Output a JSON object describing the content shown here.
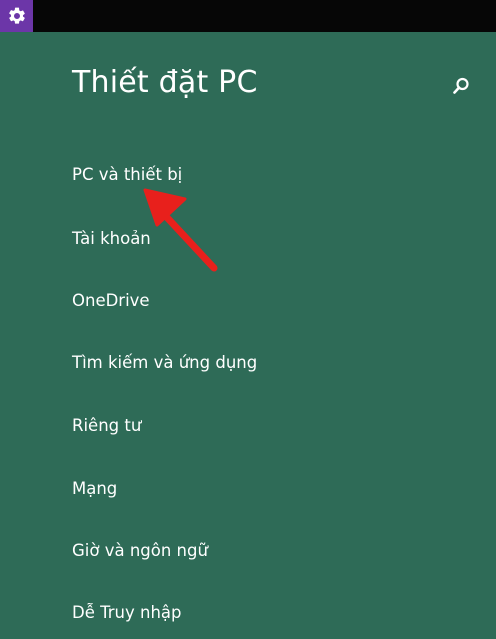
{
  "window": {
    "app_icon": "gear-icon",
    "topbar_color": "#060606",
    "app_icon_color": "#6c36a8"
  },
  "header": {
    "title": "Thiết đặt PC",
    "search_icon": "search-icon"
  },
  "theme": {
    "background": "#2e6b57",
    "text": "#ffffff",
    "annotation_arrow": "#e8201c"
  },
  "nav": {
    "items": [
      {
        "label": "PC và thiết bị"
      },
      {
        "label": "Tài khoản"
      },
      {
        "label": "OneDrive"
      },
      {
        "label": "Tìm kiếm và ứng dụng"
      },
      {
        "label": "Riêng tư"
      },
      {
        "label": "Mạng"
      },
      {
        "label": "Giờ và ngôn ngữ"
      },
      {
        "label": "Dễ Truy nhập"
      }
    ]
  }
}
